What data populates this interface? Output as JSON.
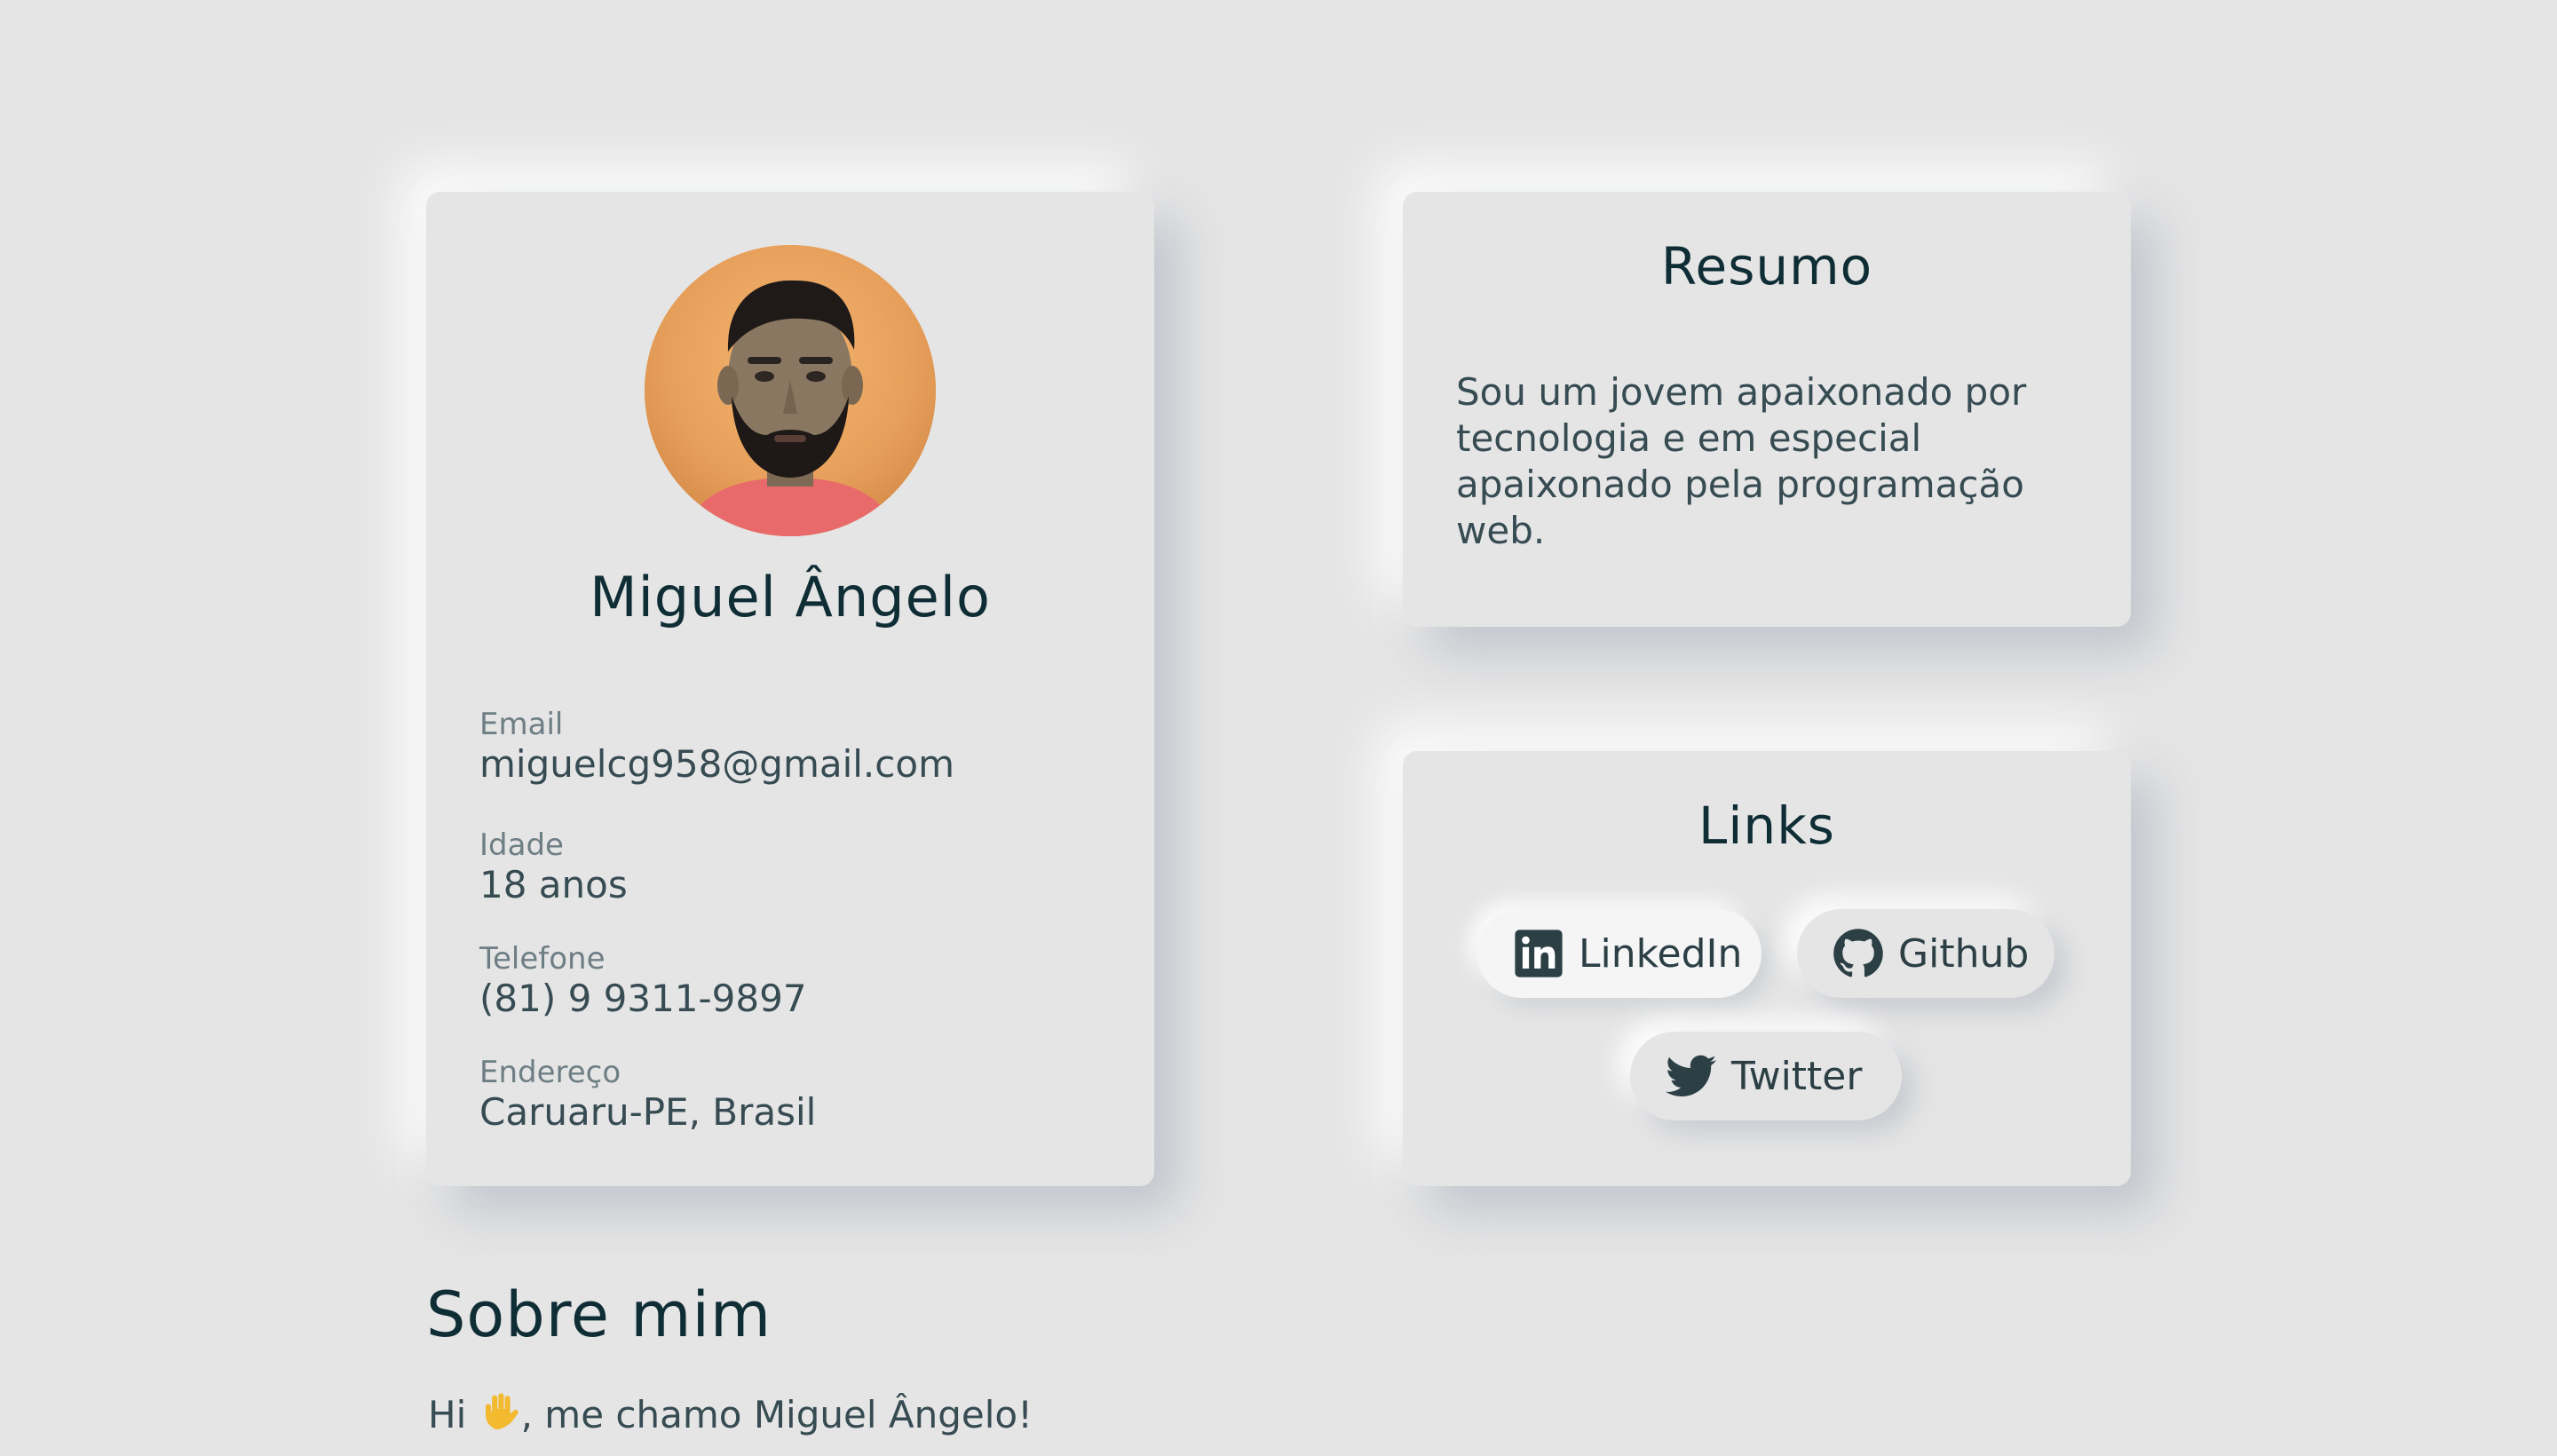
{
  "profile": {
    "name": "Miguel Ângelo",
    "fields": [
      {
        "label": "Email",
        "value": "miguelcg958@gmail.com"
      },
      {
        "label": "Idade",
        "value": "18 anos"
      },
      {
        "label": "Telefone",
        "value": "(81) 9 9311-9897"
      },
      {
        "label": "Endereço",
        "value": "Caruaru-PE, Brasil"
      }
    ]
  },
  "resumo": {
    "title": "Resumo",
    "text": "Sou um jovem apaixonado por tecnologia e em especial apaixonado pela programação web."
  },
  "links": {
    "title": "Links",
    "items": [
      {
        "label": "LinkedIn",
        "icon": "linkedin-icon"
      },
      {
        "label": "Github",
        "icon": "github-icon"
      },
      {
        "label": "Twitter",
        "icon": "twitter-icon"
      }
    ]
  },
  "about": {
    "title": "Sobre mim",
    "greeting_before": "Hi ",
    "greeting_after": ", me chamo Miguel Ângelo!",
    "wave_icon": "waving-hand-icon"
  },
  "colors": {
    "background": "#e5e5e5",
    "heading": "#0f2d35",
    "text": "#364b52",
    "label": "#6e7e85"
  }
}
